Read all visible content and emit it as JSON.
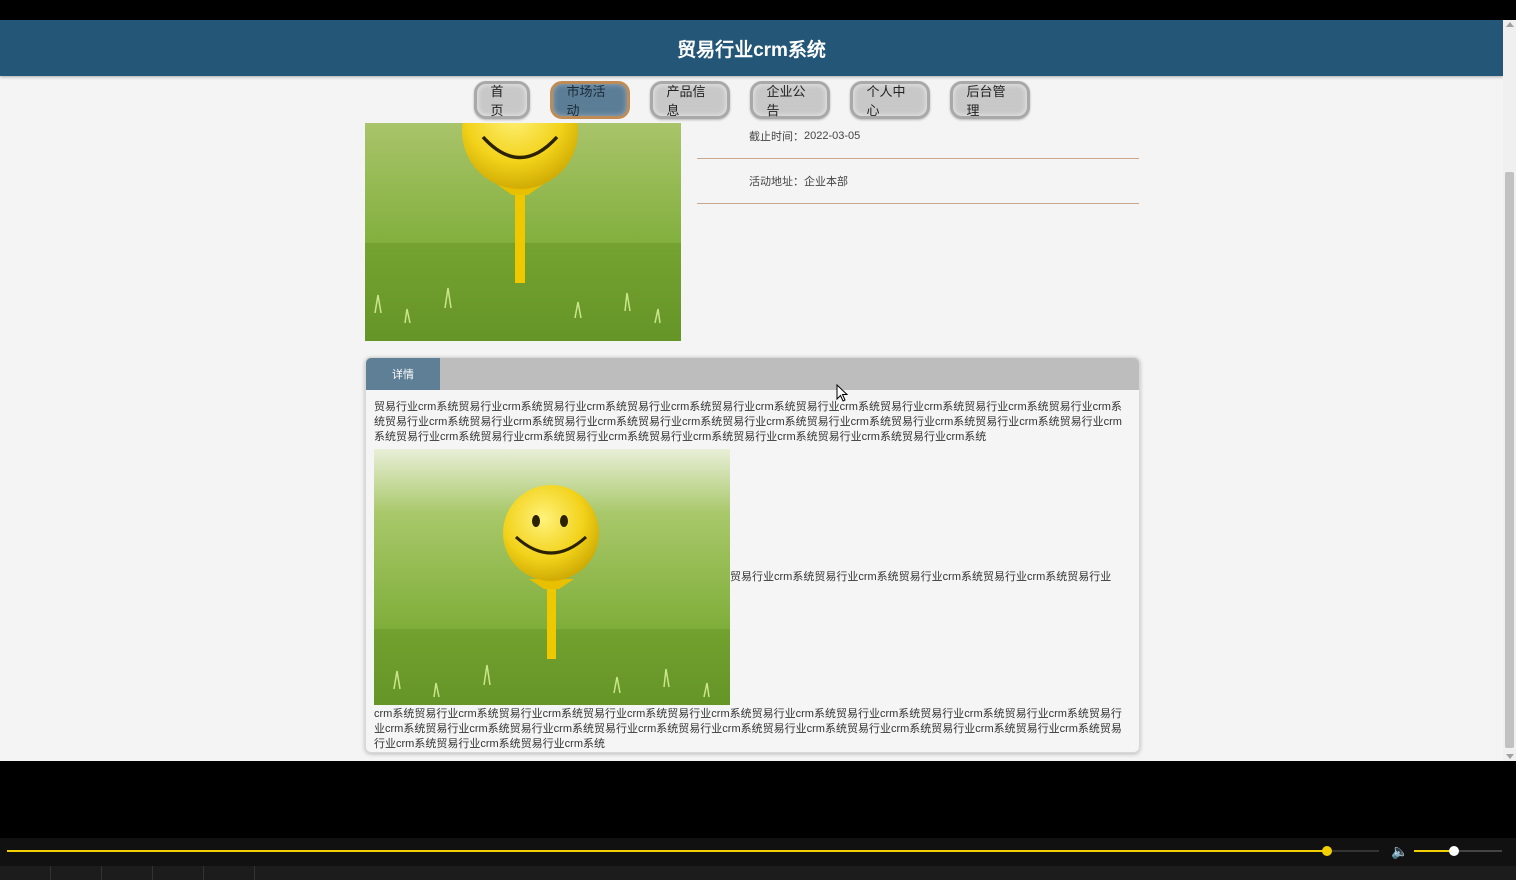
{
  "header": {
    "title": "贸易行业crm系统"
  },
  "nav": {
    "items": [
      {
        "label": "首页",
        "active": false
      },
      {
        "label": "市场活动",
        "active": true
      },
      {
        "label": "产品信息",
        "active": false
      },
      {
        "label": "企业公告",
        "active": false
      },
      {
        "label": "个人中心",
        "active": false
      },
      {
        "label": "后台管理",
        "active": false
      }
    ]
  },
  "info": {
    "rows": [
      {
        "label": "截止时间：",
        "value": "2022-03-05"
      },
      {
        "label": "活动地址：",
        "value": "企业本部"
      }
    ]
  },
  "detail": {
    "tab_label": "详情",
    "para1": "贸易行业crm系统贸易行业crm系统贸易行业crm系统贸易行业crm系统贸易行业crm系统贸易行业crm系统贸易行业crm系统贸易行业crm系统贸易行业crm系统贸易行业crm系统贸易行业crm系统贸易行业crm系统贸易行业crm系统贸易行业crm系统贸易行业crm系统贸易行业crm系统贸易行业crm系统贸易行业crm系统贸易行业crm系统贸易行业crm系统贸易行业crm系统贸易行业crm系统贸易行业crm系统贸易行业crm系统贸易行业crm系统",
    "inline_text": "贸易行业crm系统贸易行业crm系统贸易行业crm系统贸易行业crm系统贸易行业",
    "para2": "crm系统贸易行业crm系统贸易行业crm系统贸易行业crm系统贸易行业crm系统贸易行业crm系统贸易行业crm系统贸易行业crm系统贸易行业crm系统贸易行业crm系统贸易行业crm系统贸易行业crm系统贸易行业crm系统贸易行业crm系统贸易行业crm系统贸易行业crm系统贸易行业crm系统贸易行业crm系统贸易行业crm系统贸易行业crm系统贸易行业crm系统"
  },
  "player": {
    "progress_fraction": 0.962,
    "volume_fraction": 0.45
  },
  "colors": {
    "header": "#235677",
    "active_nav": "#5c7d96",
    "tab": "#5f7f96",
    "progress": "#f2d000"
  }
}
